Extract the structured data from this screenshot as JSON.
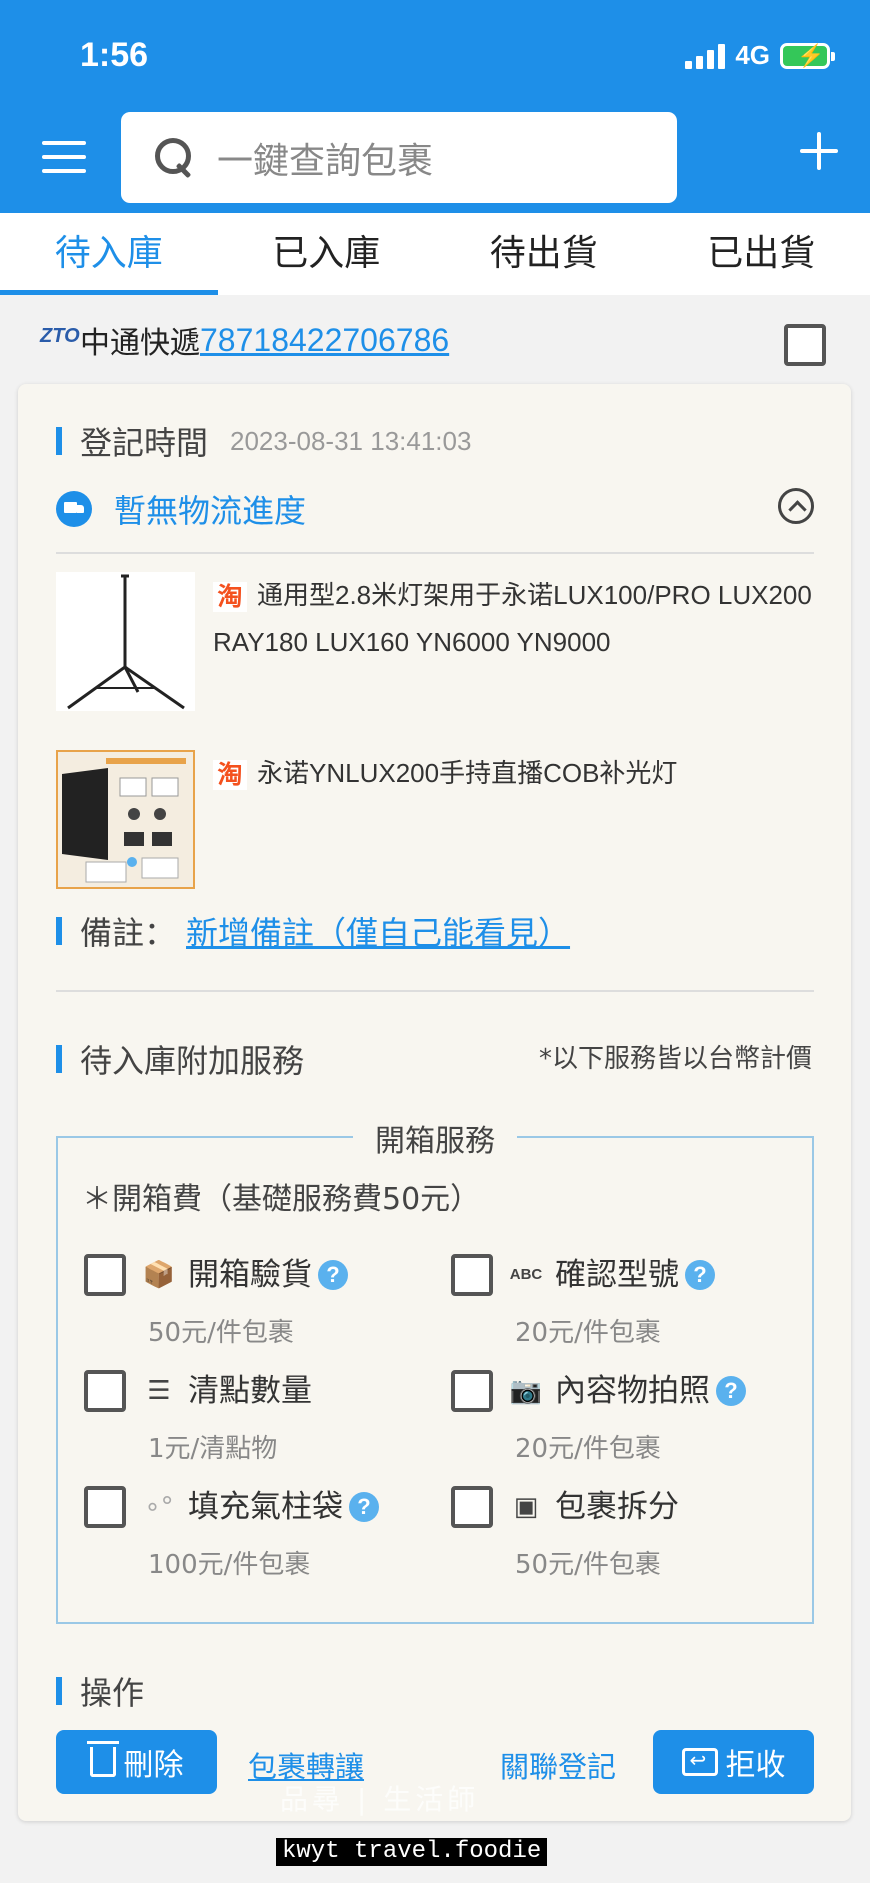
{
  "status": {
    "time": "1:56",
    "network": "4G"
  },
  "header": {
    "search_placeholder": "一鍵查詢包裹"
  },
  "tabs": [
    {
      "label": "待入庫",
      "active": true
    },
    {
      "label": "已入庫",
      "active": false
    },
    {
      "label": "待出貨",
      "active": false
    },
    {
      "label": "已出貨",
      "active": false
    }
  ],
  "parcel": {
    "carrier_logo": "ZTO",
    "carrier": "中通快遞",
    "tracking_no": "78718422706786",
    "register_label": "登記時間",
    "register_time": "2023-08-31 13:41:03",
    "progress": "暫無物流進度",
    "products": [
      {
        "store_icon": "淘",
        "title": "通用型2.8米灯架用于永诺LUX100/PRO LUX200 RAY180 LUX160 YN6000 YN9000"
      },
      {
        "store_icon": "淘",
        "title": "永诺YNLUX200手持直播COB补光灯"
      }
    ],
    "remark_label": "備註：",
    "remark_link": "新增備註（僅自己能看見）"
  },
  "services": {
    "title": "待入庫附加服務",
    "note": "*以下服務皆以台幣計價",
    "box_title": "開箱服務",
    "fee_note": "＊開箱費（基礎服務費50元）",
    "items": [
      {
        "name": "開箱驗貨",
        "price": "50元/件包裹",
        "icon": "unbox-icon",
        "help": "?"
      },
      {
        "name": "確認型號",
        "price": "20元/件包裹",
        "icon": "abc-icon",
        "help": "?"
      },
      {
        "name": "清點數量",
        "price": "1元/清點物",
        "icon": "list-icon",
        "help": ""
      },
      {
        "name": "內容物拍照",
        "price": "20元/件包裹",
        "icon": "camera-icon",
        "help": "?"
      },
      {
        "name": "填充氣柱袋",
        "price": "100元/件包裹",
        "icon": "bubbles-icon",
        "help": "?"
      },
      {
        "name": "包裹拆分",
        "price": "50元/件包裹",
        "icon": "boxes-icon",
        "help": ""
      }
    ]
  },
  "operations": {
    "title": "操作",
    "delete": "刪除",
    "transfer": "包裹轉讓",
    "link_register": "關聯登記",
    "reject": "拒收"
  },
  "watermark": {
    "line1": "品尋 | 生活師",
    "line2": "kwyt travel.foodie"
  },
  "colors": {
    "primary": "#1e8fe8",
    "taobao": "#f4511e"
  }
}
